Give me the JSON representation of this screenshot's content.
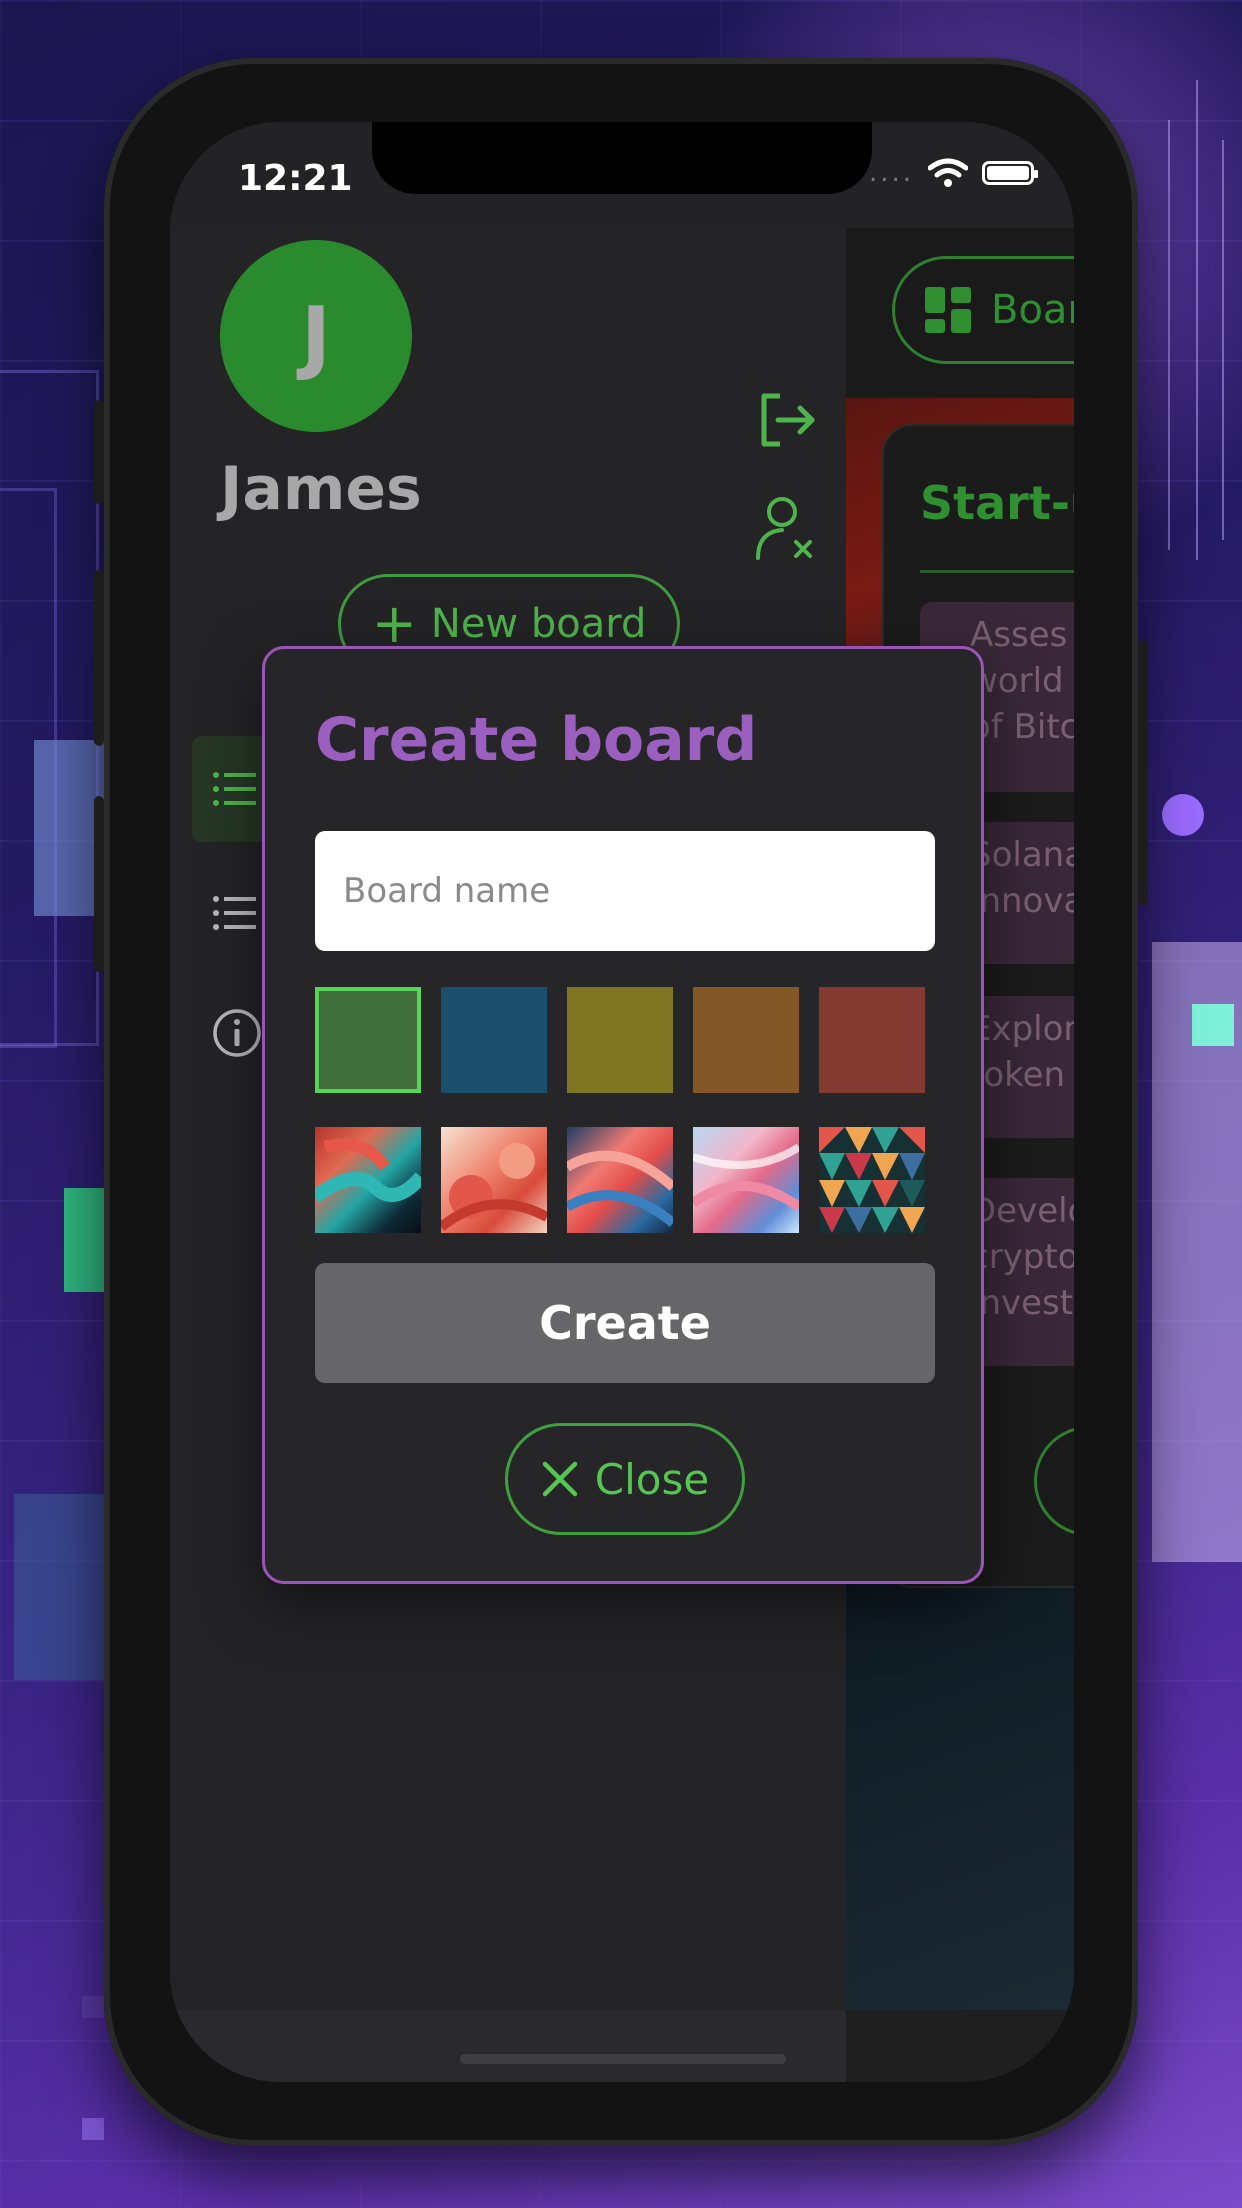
{
  "status_bar": {
    "time": "12:21"
  },
  "drawer": {
    "avatar_initial": "J",
    "username": "James",
    "new_board_label": "New board"
  },
  "board": {
    "tab_label": "Boar",
    "card_title": "Start-u",
    "tasks": [
      "Asses\nworld\nof Bitc",
      "Solana\ninnova",
      "Explor\ntoken",
      "Develo\ncrypto\ninvest"
    ]
  },
  "modal": {
    "title": "Create board",
    "name_placeholder": "Board name",
    "color_swatches": [
      "#3f6e3a",
      "#1c4f6e",
      "#7f7522",
      "#845826",
      "#823a31"
    ],
    "selected_color_index": 0,
    "image_thumbnails": [
      "swirl-teal-red",
      "coral-clouds",
      "coral-blue-waves",
      "pastel-blue-pink-waves",
      "geometric-triangles"
    ],
    "create_label": "Create",
    "close_label": "Close"
  },
  "colors": {
    "accent_green": "#4fb44c",
    "accent_purple": "#9b5fc0",
    "avatar_green": "#2a8a2e"
  }
}
